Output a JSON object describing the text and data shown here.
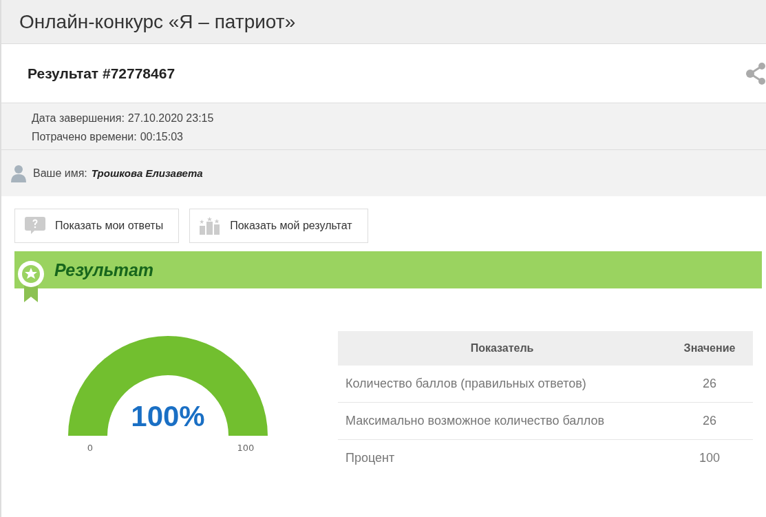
{
  "page_title": "Онлайн-конкурс «Я – патриот»",
  "result": {
    "title": "Результат #72778467"
  },
  "info": [
    {
      "label": "Дата завершения:",
      "value": "27.10.2020 23:15"
    },
    {
      "label": "Потрачено времени:",
      "value": "00:15:03"
    }
  ],
  "user": {
    "label": "Ваше имя:",
    "name": "Трошкова Елизавета"
  },
  "buttons": [
    {
      "kind": "answers",
      "label": "Показать мои ответы"
    },
    {
      "kind": "result",
      "label": "Показать мой результат"
    }
  ],
  "section": {
    "title": "Результат"
  },
  "gauge": {
    "level": 1,
    "reading": "100%",
    "min_label": "0",
    "max_label": "100"
  },
  "table": {
    "columns": [
      "Показатель",
      "Значение"
    ],
    "rows": [
      [
        "Количество баллов (правильных ответов)",
        "26"
      ],
      [
        "Максимально возможное количество баллов",
        "26"
      ],
      [
        "Процент",
        "100"
      ]
    ]
  }
}
